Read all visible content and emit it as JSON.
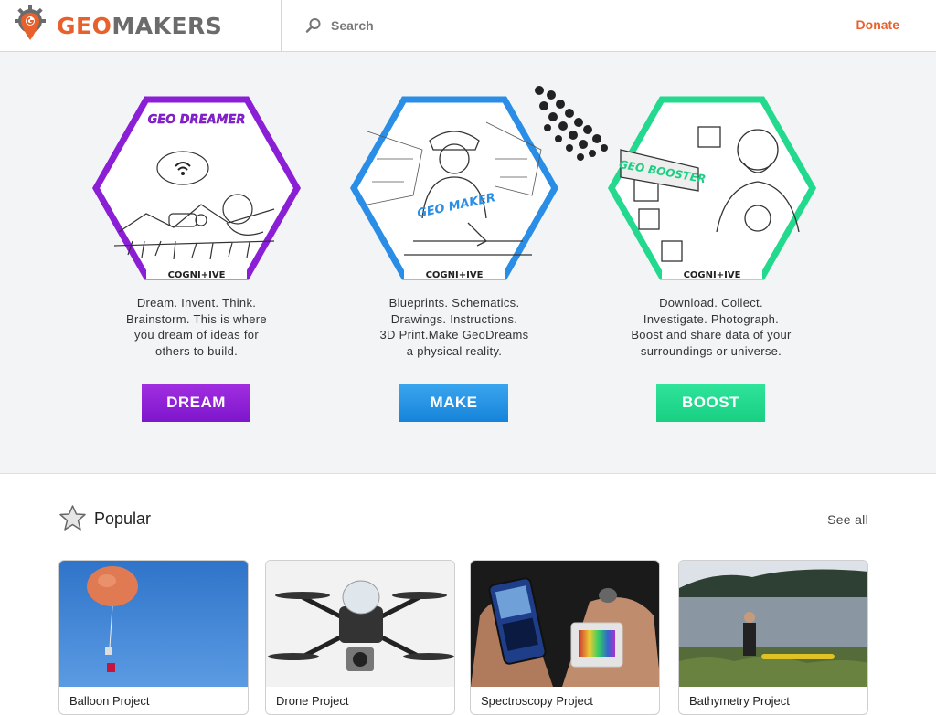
{
  "header": {
    "logo_geo": "GEO",
    "logo_makers": "MAKERS",
    "search_placeholder": "Search",
    "donate_label": "Donate"
  },
  "hero": {
    "columns": [
      {
        "badge_text": "GEO DREAMER",
        "badge_footer": "COGNI+IVE",
        "description": [
          "Dream. Invent. Think.",
          "Brainstorm. This is where",
          "you dream of ideas for",
          "others to build."
        ],
        "button_label": "DREAM",
        "accent": "#8a1fd6"
      },
      {
        "badge_text": "GEO MAKER",
        "badge_footer": "COGNI+IVE",
        "description": [
          "Blueprints. Schematics.",
          "Drawings. Instructions.",
          "3D Print.Make GeoDreams",
          "a physical reality."
        ],
        "button_label": "MAKE",
        "accent": "#2a8ee6"
      },
      {
        "badge_text": "GEO BOOSTER",
        "badge_footer": "COGNI+IVE",
        "description": [
          "Download. Collect.",
          "Investigate. Photograph.",
          "Boost and share data of your",
          "surroundings or universe."
        ],
        "button_label": "BOOST",
        "accent": "#22d98d"
      }
    ]
  },
  "popular": {
    "title": "Popular",
    "see_all_label": "See all",
    "cards": [
      {
        "title": "Balloon Project"
      },
      {
        "title": "Drone Project"
      },
      {
        "title": "Spectroscopy Project"
      },
      {
        "title": "Bathymetry Project"
      }
    ]
  }
}
